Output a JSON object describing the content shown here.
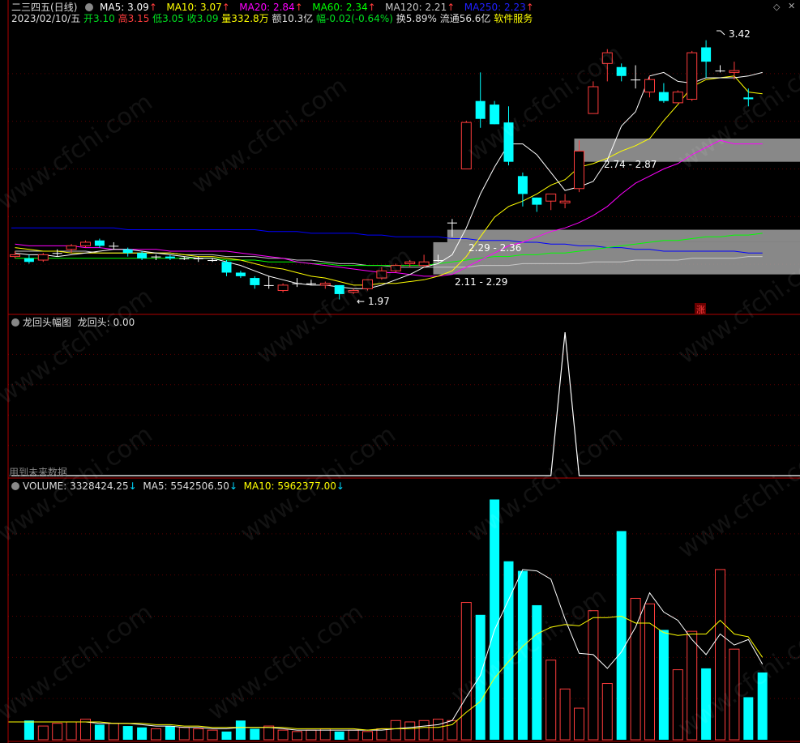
{
  "header": {
    "stock_name": "二三四五",
    "period": "(日线)",
    "ma": [
      {
        "label": "MA5: 3.09",
        "color": "#ffffff",
        "arrow": "↑"
      },
      {
        "label": "MA10: 3.07",
        "color": "#ffff00",
        "arrow": "↑"
      },
      {
        "label": "MA20: 2.84",
        "color": "#ff00ff",
        "arrow": "↑"
      },
      {
        "label": "MA60: 2.34",
        "color": "#00ff00",
        "arrow": "↑"
      },
      {
        "label": "MA120: 2.21",
        "color": "#c8c8c8",
        "arrow": "↑"
      },
      {
        "label": "MA250: 2.23",
        "color": "#0000ff",
        "arrow": "↑"
      }
    ],
    "date": "2023/02/10/五",
    "open": "开3.10",
    "high": "高3.15",
    "low": "低3.05",
    "close": "收3.09",
    "volume": "量332.8万",
    "amount": "额10.3亿",
    "change": "幅-0.02(-0.64%)",
    "turnover": "换5.89%",
    "float_cap": "流通56.6亿",
    "industry": "软件服务"
  },
  "annotations": {
    "high_label": "3.42",
    "low_label": "1.97",
    "zone1_label": "2.74 - 2.87",
    "zone2_label": "2.29 - 2.36",
    "zone3_label": "2.11 - 2.29",
    "zhang_badge": "涨"
  },
  "indicator": {
    "title": "龙回头幅图",
    "value_label": "龙回头: 0.00",
    "footnote": "用到未来数据"
  },
  "volume_panel": {
    "volume_label": "VOLUME: 3328424.25",
    "ma5_label": "MA5: 5542506.50",
    "ma10_label": "MA10: 5962377.00",
    "arrow_down": "↓"
  },
  "watermark": "www.cfchi.com",
  "colors": {
    "up": "#ff3c3c",
    "down": "#00ffff",
    "ma5": "#ffffff",
    "ma10": "#ffff00",
    "ma20": "#ff00ff",
    "ma60": "#00ff00",
    "ma120": "#c8c8c8",
    "ma250": "#0000ff",
    "zone": "#a0a0a0",
    "panel_border": "#b00000"
  },
  "chart_data": {
    "type": "candlestick",
    "price_range": [
      1.9,
      3.5
    ],
    "candles": [
      {
        "o": 2.21,
        "c": 2.22,
        "h": 2.24,
        "l": 2.2
      },
      {
        "o": 2.2,
        "c": 2.18,
        "h": 2.22,
        "l": 2.17
      },
      {
        "o": 2.19,
        "c": 2.22,
        "h": 2.23,
        "l": 2.18
      },
      {
        "o": 2.23,
        "c": 2.23,
        "h": 2.25,
        "l": 2.21
      },
      {
        "o": 2.25,
        "c": 2.27,
        "h": 2.28,
        "l": 2.23
      },
      {
        "o": 2.27,
        "c": 2.29,
        "h": 2.3,
        "l": 2.26
      },
      {
        "o": 2.3,
        "c": 2.27,
        "h": 2.31,
        "l": 2.26
      },
      {
        "o": 2.27,
        "c": 2.27,
        "h": 2.29,
        "l": 2.25
      },
      {
        "o": 2.25,
        "c": 2.23,
        "h": 2.26,
        "l": 2.21
      },
      {
        "o": 2.23,
        "c": 2.2,
        "h": 2.24,
        "l": 2.19
      },
      {
        "o": 2.21,
        "c": 2.21,
        "h": 2.22,
        "l": 2.19
      },
      {
        "o": 2.21,
        "c": 2.2,
        "h": 2.22,
        "l": 2.19
      },
      {
        "o": 2.2,
        "c": 2.2,
        "h": 2.21,
        "l": 2.19
      },
      {
        "o": 2.2,
        "c": 2.2,
        "h": 2.21,
        "l": 2.18
      },
      {
        "o": 2.19,
        "c": 2.19,
        "h": 2.2,
        "l": 2.18
      },
      {
        "o": 2.18,
        "c": 2.12,
        "h": 2.19,
        "l": 2.1
      },
      {
        "o": 2.12,
        "c": 2.1,
        "h": 2.13,
        "l": 2.09
      },
      {
        "o": 2.09,
        "c": 2.05,
        "h": 2.1,
        "l": 2.03
      },
      {
        "o": 2.05,
        "c": 2.05,
        "h": 2.1,
        "l": 2.03
      },
      {
        "o": 2.02,
        "c": 2.05,
        "h": 2.06,
        "l": 2.01
      },
      {
        "o": 2.06,
        "c": 2.06,
        "h": 2.09,
        "l": 2.04
      },
      {
        "o": 2.06,
        "c": 2.06,
        "h": 2.08,
        "l": 2.05
      },
      {
        "o": 2.05,
        "c": 2.06,
        "h": 2.07,
        "l": 2.03
      },
      {
        "o": 2.05,
        "c": 2.0,
        "h": 2.05,
        "l": 1.97
      },
      {
        "o": 2.01,
        "c": 2.02,
        "h": 2.03,
        "l": 2.0
      },
      {
        "o": 2.03,
        "c": 2.08,
        "h": 2.08,
        "l": 2.02
      },
      {
        "o": 2.09,
        "c": 2.13,
        "h": 2.15,
        "l": 2.08
      },
      {
        "o": 2.13,
        "c": 2.16,
        "h": 2.17,
        "l": 2.12
      },
      {
        "o": 2.17,
        "c": 2.18,
        "h": 2.19,
        "l": 2.15
      },
      {
        "o": 2.16,
        "c": 2.18,
        "h": 2.22,
        "l": 2.15
      },
      {
        "o": 2.19,
        "c": 2.19,
        "h": 2.22,
        "l": 2.18
      },
      {
        "o": 2.4,
        "c": 2.4,
        "h": 2.42,
        "l": 2.32
      },
      {
        "o": 2.7,
        "c": 2.96,
        "h": 2.97,
        "l": 2.7
      },
      {
        "o": 3.08,
        "c": 2.98,
        "h": 3.24,
        "l": 2.93
      },
      {
        "o": 3.06,
        "c": 2.95,
        "h": 3.08,
        "l": 2.95
      },
      {
        "o": 2.96,
        "c": 2.74,
        "h": 3.05,
        "l": 2.72
      },
      {
        "o": 2.66,
        "c": 2.56,
        "h": 2.68,
        "l": 2.49
      },
      {
        "o": 2.54,
        "c": 2.5,
        "h": 2.54,
        "l": 2.46
      },
      {
        "o": 2.52,
        "c": 2.56,
        "h": 2.56,
        "l": 2.47
      },
      {
        "o": 2.51,
        "c": 2.52,
        "h": 2.56,
        "l": 2.48
      },
      {
        "o": 2.59,
        "c": 2.8,
        "h": 2.86,
        "l": 2.57
      },
      {
        "o": 3.01,
        "c": 3.16,
        "h": 3.19,
        "l": 3.01
      },
      {
        "o": 3.29,
        "c": 3.35,
        "h": 3.37,
        "l": 3.19
      },
      {
        "o": 3.27,
        "c": 3.22,
        "h": 3.29,
        "l": 3.19
      },
      {
        "o": 3.2,
        "c": 3.2,
        "h": 3.28,
        "l": 3.15
      },
      {
        "o": 3.13,
        "c": 3.2,
        "h": 3.22,
        "l": 3.1
      },
      {
        "o": 3.13,
        "c": 3.08,
        "h": 3.18,
        "l": 3.07
      },
      {
        "o": 3.07,
        "c": 3.13,
        "h": 3.14,
        "l": 3.07
      },
      {
        "o": 3.09,
        "c": 3.35,
        "h": 3.36,
        "l": 3.08
      },
      {
        "o": 3.38,
        "c": 3.3,
        "h": 3.42,
        "l": 3.21
      },
      {
        "o": 3.25,
        "c": 3.25,
        "h": 3.28,
        "l": 3.24
      },
      {
        "o": 3.24,
        "c": 3.25,
        "h": 3.3,
        "l": 3.2
      },
      {
        "o": 3.1,
        "c": 3.09,
        "h": 3.15,
        "l": 3.05
      }
    ],
    "ma5": [
      2.23,
      2.22,
      2.22,
      2.21,
      2.22,
      2.23,
      2.24,
      2.25,
      2.25,
      2.24,
      2.23,
      2.22,
      2.21,
      2.2,
      2.2,
      2.18,
      2.16,
      2.13,
      2.1,
      2.08,
      2.06,
      2.05,
      2.05,
      2.04,
      2.03,
      2.03,
      2.05,
      2.08,
      2.11,
      2.15,
      2.17,
      2.22,
      2.37,
      2.56,
      2.71,
      2.84,
      2.84,
      2.78,
      2.68,
      2.58,
      2.6,
      2.63,
      2.75,
      2.94,
      3.02,
      3.22,
      3.24,
      3.19,
      3.18,
      3.21,
      3.21,
      3.21,
      3.22,
      3.24
    ],
    "ma10": [
      2.26,
      2.25,
      2.24,
      2.24,
      2.23,
      2.23,
      2.23,
      2.23,
      2.23,
      2.23,
      2.23,
      2.23,
      2.22,
      2.21,
      2.21,
      2.2,
      2.19,
      2.17,
      2.15,
      2.14,
      2.12,
      2.1,
      2.09,
      2.07,
      2.05,
      2.05,
      2.06,
      2.06,
      2.07,
      2.08,
      2.1,
      2.13,
      2.21,
      2.32,
      2.43,
      2.49,
      2.52,
      2.56,
      2.61,
      2.64,
      2.71,
      2.73,
      2.76,
      2.8,
      2.83,
      2.87,
      2.97,
      3.06,
      3.16,
      3.2,
      3.21,
      3.22,
      3.13,
      3.12
    ],
    "ma20": [
      2.28,
      2.27,
      2.27,
      2.27,
      2.27,
      2.26,
      2.26,
      2.25,
      2.25,
      2.25,
      2.25,
      2.24,
      2.24,
      2.24,
      2.24,
      2.24,
      2.23,
      2.22,
      2.21,
      2.2,
      2.18,
      2.17,
      2.16,
      2.15,
      2.14,
      2.13,
      2.12,
      2.12,
      2.11,
      2.1,
      2.1,
      2.11,
      2.15,
      2.19,
      2.23,
      2.27,
      2.29,
      2.32,
      2.35,
      2.37,
      2.4,
      2.44,
      2.49,
      2.56,
      2.62,
      2.66,
      2.7,
      2.73,
      2.78,
      2.82,
      2.86,
      2.84,
      2.84,
      2.84
    ],
    "ma60": [
      2.2,
      2.2,
      2.2,
      2.2,
      2.2,
      2.2,
      2.2,
      2.2,
      2.2,
      2.2,
      2.2,
      2.2,
      2.2,
      2.2,
      2.2,
      2.19,
      2.19,
      2.19,
      2.18,
      2.18,
      2.18,
      2.17,
      2.17,
      2.16,
      2.16,
      2.16,
      2.16,
      2.16,
      2.16,
      2.16,
      2.17,
      2.18,
      2.19,
      2.2,
      2.21,
      2.21,
      2.22,
      2.22,
      2.23,
      2.23,
      2.24,
      2.25,
      2.26,
      2.27,
      2.28,
      2.29,
      2.3,
      2.3,
      2.31,
      2.32,
      2.32,
      2.33,
      2.33,
      2.34
    ],
    "ma120": [
      2.24,
      2.24,
      2.24,
      2.24,
      2.24,
      2.24,
      2.23,
      2.23,
      2.23,
      2.23,
      2.23,
      2.23,
      2.22,
      2.22,
      2.22,
      2.21,
      2.21,
      2.21,
      2.2,
      2.2,
      2.19,
      2.19,
      2.18,
      2.17,
      2.17,
      2.16,
      2.16,
      2.15,
      2.15,
      2.15,
      2.15,
      2.15,
      2.15,
      2.16,
      2.16,
      2.16,
      2.17,
      2.17,
      2.17,
      2.17,
      2.17,
      2.18,
      2.18,
      2.18,
      2.19,
      2.19,
      2.19,
      2.19,
      2.2,
      2.2,
      2.2,
      2.2,
      2.21,
      2.21
    ],
    "ma250": [
      2.37,
      2.37,
      2.37,
      2.37,
      2.37,
      2.37,
      2.37,
      2.37,
      2.36,
      2.36,
      2.36,
      2.36,
      2.36,
      2.36,
      2.36,
      2.36,
      2.36,
      2.36,
      2.35,
      2.35,
      2.35,
      2.34,
      2.34,
      2.34,
      2.34,
      2.33,
      2.33,
      2.32,
      2.32,
      2.32,
      2.32,
      2.31,
      2.31,
      2.3,
      2.3,
      2.3,
      2.29,
      2.29,
      2.28,
      2.28,
      2.27,
      2.27,
      2.26,
      2.26,
      2.25,
      2.25,
      2.24,
      2.24,
      2.24,
      2.24,
      2.24,
      2.24,
      2.23,
      2.23
    ],
    "zones": [
      {
        "low": 2.74,
        "high": 2.87,
        "start_index": 40
      },
      {
        "low": 2.29,
        "high": 2.36,
        "start_index": 31
      },
      {
        "low": 2.11,
        "high": 2.29,
        "start_index": 30
      }
    ],
    "indicator_values": [
      0,
      0,
      0,
      0,
      0,
      0,
      0,
      0,
      0,
      0,
      0,
      0,
      0,
      0,
      0,
      0,
      0,
      0,
      0,
      0,
      0,
      0,
      0,
      0,
      0,
      0,
      0,
      0,
      0,
      0,
      0,
      0,
      0,
      0,
      0,
      0,
      0,
      0,
      0,
      1,
      0,
      0,
      0,
      0,
      0,
      0,
      0,
      0,
      0,
      0,
      0,
      0,
      0,
      0
    ],
    "volume": [
      1.4,
      1.0,
      1.2,
      1.3,
      1.5,
      1.1,
      1.2,
      1.0,
      0.9,
      0.8,
      1.0,
      0.9,
      0.8,
      0.7,
      0.6,
      1.4,
      0.8,
      1.0,
      0.7,
      0.6,
      0.7,
      0.8,
      0.6,
      0.7,
      0.6,
      0.8,
      1.4,
      1.3,
      1.4,
      1.5,
      1.4,
      10.0,
      9.1,
      17.5,
      13.0,
      12.3,
      9.8,
      5.8,
      3.7,
      2.3,
      9.4,
      4.1,
      15.2,
      10.3,
      9.9,
      8.0,
      5.1,
      7.9,
      5.2,
      12.4,
      6.6,
      3.1,
      4.9
    ],
    "volume_ma5": [
      1.3,
      1.3,
      1.3,
      1.3,
      1.3,
      1.2,
      1.2,
      1.2,
      1.1,
      1.0,
      1.0,
      0.9,
      0.9,
      0.8,
      0.8,
      0.9,
      0.9,
      0.9,
      0.8,
      0.7,
      0.7,
      0.7,
      0.7,
      0.7,
      0.7,
      0.7,
      0.8,
      0.9,
      1.0,
      1.1,
      1.4,
      3.1,
      4.7,
      8.0,
      10.2,
      12.4,
      12.3,
      11.7,
      8.8,
      6.3,
      6.2,
      5.2,
      6.4,
      8.2,
      10.7,
      9.3,
      8.7,
      7.3,
      6.2,
      7.7,
      6.9,
      7.3,
      5.5
    ],
    "volume_ma10": [
      1.3,
      1.3,
      1.3,
      1.3,
      1.3,
      1.3,
      1.2,
      1.2,
      1.2,
      1.1,
      1.1,
      1.0,
      1.0,
      0.9,
      0.9,
      0.9,
      0.9,
      0.9,
      0.9,
      0.8,
      0.8,
      0.8,
      0.8,
      0.8,
      0.7,
      0.8,
      0.8,
      0.8,
      0.9,
      0.9,
      1.1,
      2.0,
      2.8,
      4.5,
      5.7,
      6.8,
      7.7,
      8.2,
      8.4,
      8.3,
      8.9,
      8.9,
      9.0,
      8.5,
      8.5,
      7.8,
      7.6,
      7.7,
      7.7,
      8.7,
      7.7,
      7.5,
      6.0
    ]
  }
}
